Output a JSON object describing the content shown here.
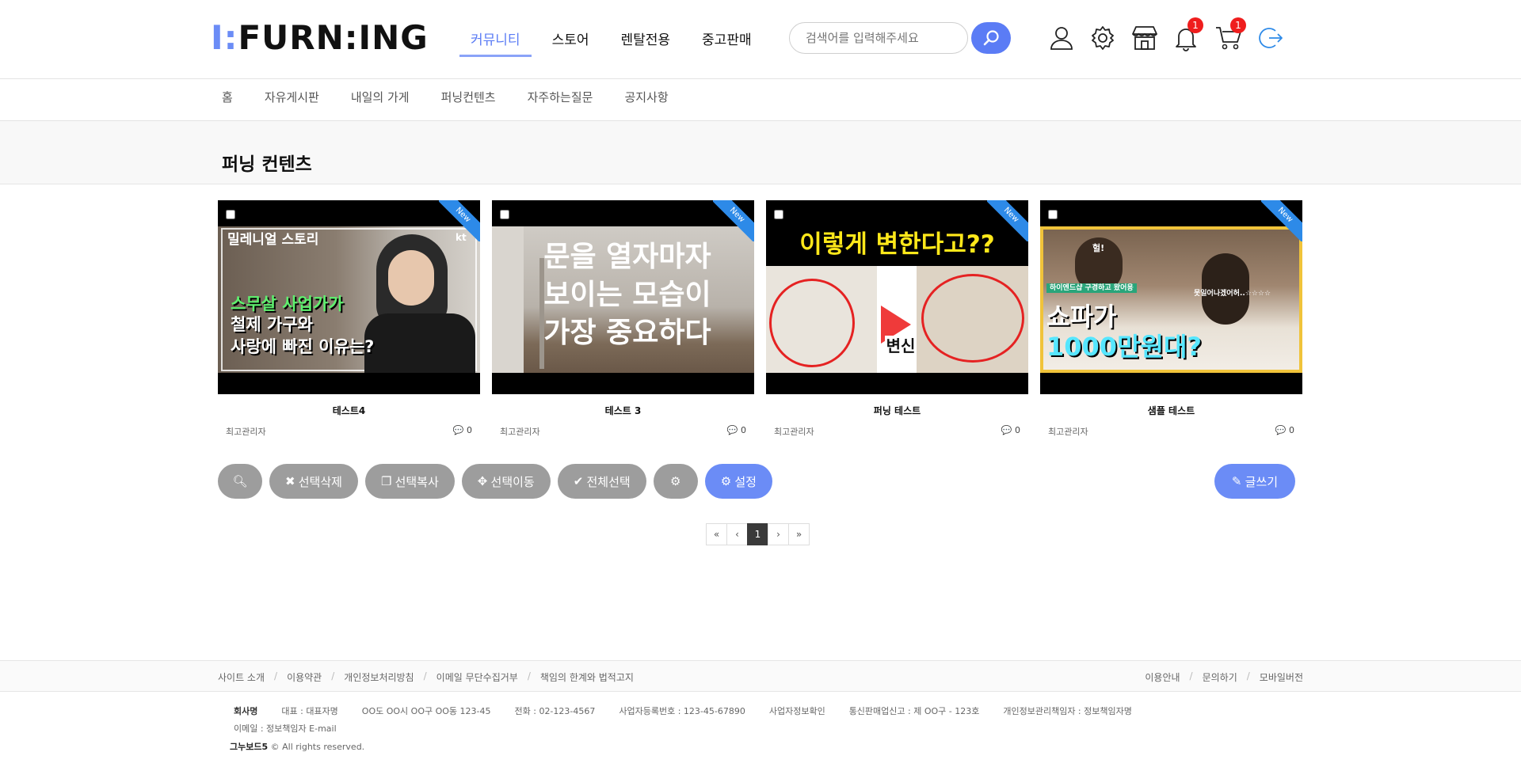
{
  "logo": {
    "prefix": "I:",
    "text": "FURN:ING"
  },
  "mainnav": [
    "커뮤니티",
    "스토어",
    "렌탈전용",
    "중고판매"
  ],
  "search": {
    "placeholder": "검색어를 입력해주세요"
  },
  "badges": {
    "notifications": "1",
    "cart": "1"
  },
  "subnav": [
    "홈",
    "자유게시판",
    "내일의 가게",
    "퍼닝컨텐츠",
    "자주하는질문",
    "공지사항"
  ],
  "page_title": "퍼닝 컨텐츠",
  "new_label": "New",
  "cards": [
    {
      "title": "테스트4",
      "author": "최고관리자",
      "comments": "0",
      "thumb_lines": [
        "밀레니얼 스토리",
        "스무살 사업가가",
        "철제 가구와",
        "사랑에 빠진 이유는?"
      ],
      "thumb_logo": "kt"
    },
    {
      "title": "테스트 3",
      "author": "최고관리자",
      "comments": "0",
      "thumb_lines": [
        "문을 열자마자",
        "보이는 모습이",
        "가장 중요하다"
      ]
    },
    {
      "title": "퍼닝 테스트",
      "author": "최고관리자",
      "comments": "0",
      "thumb_lines": [
        "이렇게 변한다고??",
        "변신"
      ]
    },
    {
      "title": "샘플 테스트",
      "author": "최고관리자",
      "comments": "0",
      "thumb_lines": [
        "헐!",
        "하이엔드샵 구경하고 왔어용",
        "못일어나겠어허..☆☆☆☆",
        "쇼파가",
        "1000만원대?"
      ]
    }
  ],
  "buttons": {
    "delete": "선택삭제",
    "copy": "선택복사",
    "move": "선택이동",
    "select_all": "전체선택",
    "settings": "설정",
    "write": "글쓰기"
  },
  "pager": {
    "first": "«",
    "prev": "‹",
    "current": "1",
    "next": "›",
    "last": "»"
  },
  "footer": {
    "links_left": [
      "사이트 소개",
      "이용약관",
      "개인정보처리방침",
      "이메일 무단수집거부",
      "책임의 한계와 법적고지"
    ],
    "links_right": [
      "이용안내",
      "문의하기",
      "모바일버전"
    ],
    "company": "회사명",
    "ceo": "대표 : 대표자명",
    "address": "OO도 OO시 OO구 OO동 123-45",
    "phone": "전화 : 02-123-4567",
    "bizno": "사업자등록번호 : 123-45-67890",
    "bizcheck": "사업자정보확인",
    "mailorder": "통신판매업신고 : 제 OO구 - 123호",
    "privacy": "개인정보관리책임자 : 정보책임자명",
    "email": "이메일 : 정보책임자 E-mail",
    "copyright_brand": "그누보드5",
    "copyright_rest": "© All rights reserved."
  }
}
